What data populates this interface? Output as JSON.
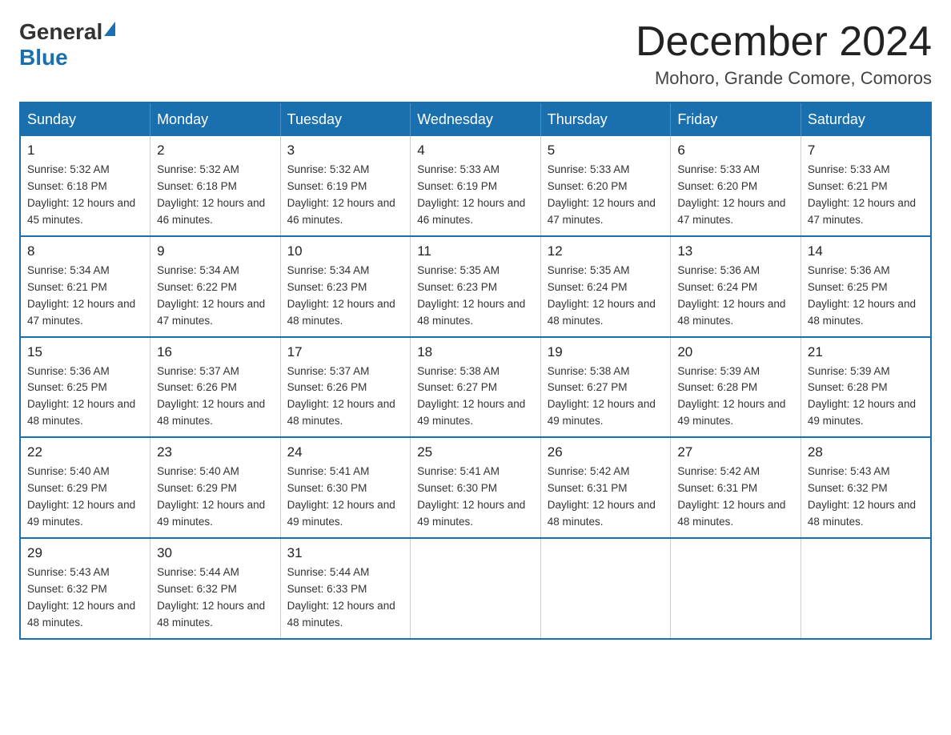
{
  "logo": {
    "general": "General",
    "blue": "Blue"
  },
  "title": "December 2024",
  "location": "Mohoro, Grande Comore, Comoros",
  "days_of_week": [
    "Sunday",
    "Monday",
    "Tuesday",
    "Wednesday",
    "Thursday",
    "Friday",
    "Saturday"
  ],
  "weeks": [
    [
      {
        "day": "1",
        "sunrise": "5:32 AM",
        "sunset": "6:18 PM",
        "daylight": "12 hours and 45 minutes."
      },
      {
        "day": "2",
        "sunrise": "5:32 AM",
        "sunset": "6:18 PM",
        "daylight": "12 hours and 46 minutes."
      },
      {
        "day": "3",
        "sunrise": "5:32 AM",
        "sunset": "6:19 PM",
        "daylight": "12 hours and 46 minutes."
      },
      {
        "day": "4",
        "sunrise": "5:33 AM",
        "sunset": "6:19 PM",
        "daylight": "12 hours and 46 minutes."
      },
      {
        "day": "5",
        "sunrise": "5:33 AM",
        "sunset": "6:20 PM",
        "daylight": "12 hours and 47 minutes."
      },
      {
        "day": "6",
        "sunrise": "5:33 AM",
        "sunset": "6:20 PM",
        "daylight": "12 hours and 47 minutes."
      },
      {
        "day": "7",
        "sunrise": "5:33 AM",
        "sunset": "6:21 PM",
        "daylight": "12 hours and 47 minutes."
      }
    ],
    [
      {
        "day": "8",
        "sunrise": "5:34 AM",
        "sunset": "6:21 PM",
        "daylight": "12 hours and 47 minutes."
      },
      {
        "day": "9",
        "sunrise": "5:34 AM",
        "sunset": "6:22 PM",
        "daylight": "12 hours and 47 minutes."
      },
      {
        "day": "10",
        "sunrise": "5:34 AM",
        "sunset": "6:23 PM",
        "daylight": "12 hours and 48 minutes."
      },
      {
        "day": "11",
        "sunrise": "5:35 AM",
        "sunset": "6:23 PM",
        "daylight": "12 hours and 48 minutes."
      },
      {
        "day": "12",
        "sunrise": "5:35 AM",
        "sunset": "6:24 PM",
        "daylight": "12 hours and 48 minutes."
      },
      {
        "day": "13",
        "sunrise": "5:36 AM",
        "sunset": "6:24 PM",
        "daylight": "12 hours and 48 minutes."
      },
      {
        "day": "14",
        "sunrise": "5:36 AM",
        "sunset": "6:25 PM",
        "daylight": "12 hours and 48 minutes."
      }
    ],
    [
      {
        "day": "15",
        "sunrise": "5:36 AM",
        "sunset": "6:25 PM",
        "daylight": "12 hours and 48 minutes."
      },
      {
        "day": "16",
        "sunrise": "5:37 AM",
        "sunset": "6:26 PM",
        "daylight": "12 hours and 48 minutes."
      },
      {
        "day": "17",
        "sunrise": "5:37 AM",
        "sunset": "6:26 PM",
        "daylight": "12 hours and 48 minutes."
      },
      {
        "day": "18",
        "sunrise": "5:38 AM",
        "sunset": "6:27 PM",
        "daylight": "12 hours and 49 minutes."
      },
      {
        "day": "19",
        "sunrise": "5:38 AM",
        "sunset": "6:27 PM",
        "daylight": "12 hours and 49 minutes."
      },
      {
        "day": "20",
        "sunrise": "5:39 AM",
        "sunset": "6:28 PM",
        "daylight": "12 hours and 49 minutes."
      },
      {
        "day": "21",
        "sunrise": "5:39 AM",
        "sunset": "6:28 PM",
        "daylight": "12 hours and 49 minutes."
      }
    ],
    [
      {
        "day": "22",
        "sunrise": "5:40 AM",
        "sunset": "6:29 PM",
        "daylight": "12 hours and 49 minutes."
      },
      {
        "day": "23",
        "sunrise": "5:40 AM",
        "sunset": "6:29 PM",
        "daylight": "12 hours and 49 minutes."
      },
      {
        "day": "24",
        "sunrise": "5:41 AM",
        "sunset": "6:30 PM",
        "daylight": "12 hours and 49 minutes."
      },
      {
        "day": "25",
        "sunrise": "5:41 AM",
        "sunset": "6:30 PM",
        "daylight": "12 hours and 49 minutes."
      },
      {
        "day": "26",
        "sunrise": "5:42 AM",
        "sunset": "6:31 PM",
        "daylight": "12 hours and 48 minutes."
      },
      {
        "day": "27",
        "sunrise": "5:42 AM",
        "sunset": "6:31 PM",
        "daylight": "12 hours and 48 minutes."
      },
      {
        "day": "28",
        "sunrise": "5:43 AM",
        "sunset": "6:32 PM",
        "daylight": "12 hours and 48 minutes."
      }
    ],
    [
      {
        "day": "29",
        "sunrise": "5:43 AM",
        "sunset": "6:32 PM",
        "daylight": "12 hours and 48 minutes."
      },
      {
        "day": "30",
        "sunrise": "5:44 AM",
        "sunset": "6:32 PM",
        "daylight": "12 hours and 48 minutes."
      },
      {
        "day": "31",
        "sunrise": "5:44 AM",
        "sunset": "6:33 PM",
        "daylight": "12 hours and 48 minutes."
      },
      null,
      null,
      null,
      null
    ]
  ]
}
